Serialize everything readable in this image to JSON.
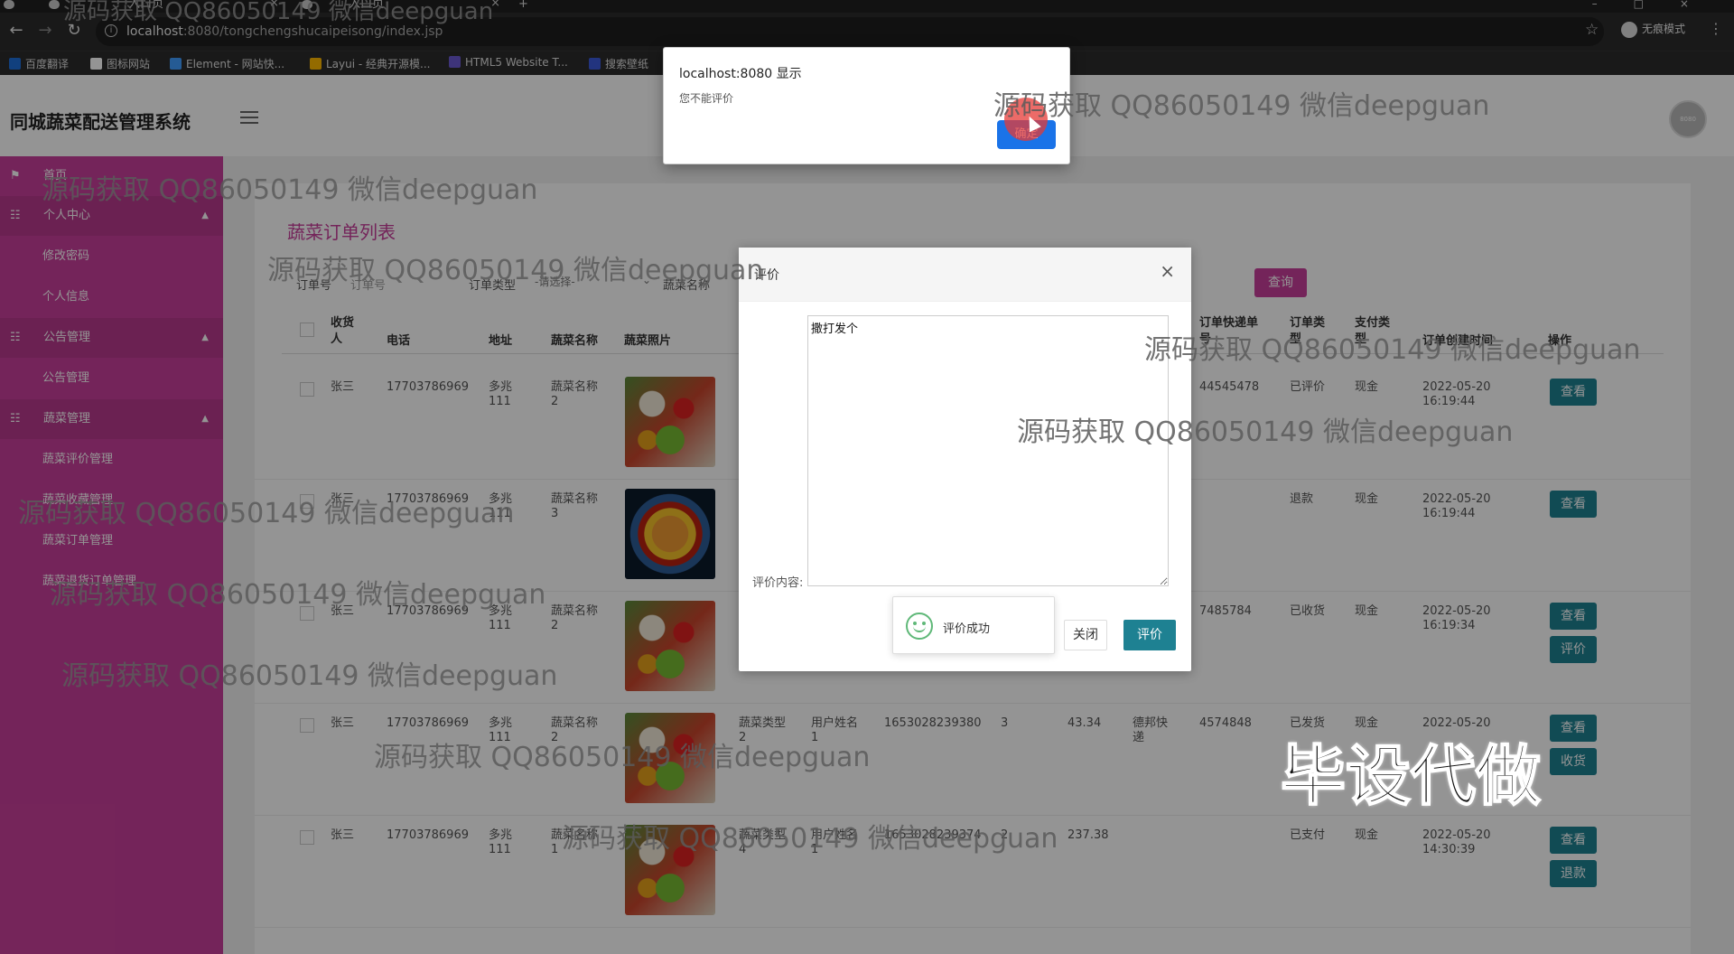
{
  "browser": {
    "tabs": [
      {
        "label": "入口页"
      },
      {
        "label": "入口页"
      }
    ],
    "new_tab": "+",
    "url_host": "localhost",
    "url_rest": ":8080/tongchengshucaipeisong/index.jsp",
    "incognito_label": "无痕模式",
    "bookmarks": [
      {
        "label": "百度翻译",
        "color": "#1e6fd9"
      },
      {
        "label": "图标网站",
        "color": "#ffffff"
      },
      {
        "label": "Element - 网站快...",
        "color": "#409eff"
      },
      {
        "label": "Layui - 经典开源模...",
        "color": "#ffb800"
      },
      {
        "label": "HTML5 Website T...",
        "color": "#6b5bd2"
      },
      {
        "label": "搜索壁纸",
        "color": "#3b5bdb"
      }
    ]
  },
  "app": {
    "title": "同城蔬菜配送管理系统",
    "avatar_text": "8080",
    "sidebar": {
      "home": "首页",
      "groups": [
        {
          "label": "个人中心",
          "items": [
            "修改密码",
            "个人信息"
          ]
        },
        {
          "label": "公告管理",
          "items": [
            "公告管理"
          ]
        },
        {
          "label": "蔬菜管理",
          "items": [
            "蔬菜评价管理",
            "蔬菜收藏管理",
            "蔬菜订单管理",
            "蔬菜退货订单管理"
          ]
        }
      ]
    },
    "content": {
      "title": "蔬菜订单列表",
      "filters": {
        "order_no_label": "订单号",
        "order_no_placeholder": "订单号",
        "type_label": "订单类型",
        "type_value": "-请选择-",
        "veg_name_label": "蔬菜名称",
        "query_button": "查询"
      },
      "columns": [
        "收货人",
        "电话",
        "地址",
        "蔬菜名称",
        "蔬菜照片",
        "订单快递单号",
        "订单类型",
        "支付类型",
        "订单创建时间",
        "操作"
      ],
      "rows": [
        {
          "receiver": "张三",
          "phone": "17703786969",
          "address": "多兆111",
          "veg": "蔬菜名称2",
          "photo": "veg1",
          "express": "44545478",
          "status": "已评价",
          "pay": "现金",
          "time": "2022-05-20 16:19:44",
          "buttons": [
            "查看"
          ]
        },
        {
          "receiver": "张三",
          "phone": "17703786969",
          "address": "多兆111",
          "veg": "蔬菜名称3",
          "photo": "veg2",
          "express": "",
          "status": "退款",
          "pay": "现金",
          "time": "2022-05-20 16:19:44",
          "buttons": [
            "查看"
          ]
        },
        {
          "receiver": "张三",
          "phone": "17703786969",
          "address": "多兆111",
          "veg": "蔬菜名称2",
          "photo": "veg1",
          "express": "7485784",
          "status": "已收货",
          "pay": "现金",
          "time": "2022-05-20 16:19:34",
          "buttons": [
            "查看",
            "评价"
          ]
        },
        {
          "receiver": "张三",
          "phone": "17703786969",
          "address": "多兆111",
          "veg": "蔬菜名称2",
          "photo": "veg1",
          "veg_type": "蔬菜类型2",
          "user": "用户姓名1",
          "order_no": "1653028239380",
          "qty": "3",
          "price": "43.34",
          "courier": "德邦快递",
          "express": "4574848",
          "status": "已发货",
          "pay": "现金",
          "time": "2022-05-20",
          "buttons": [
            "查看",
            "收货"
          ]
        },
        {
          "receiver": "张三",
          "phone": "17703786969",
          "address": "多兆111",
          "veg": "蔬菜名称1",
          "photo": "veg1",
          "veg_type": "蔬菜类型4",
          "user": "用户姓名1",
          "order_no": "1653028239374",
          "qty": "2",
          "price": "237.38",
          "express": "",
          "status": "已支付",
          "pay": "现金",
          "time": "2022-05-20 14:30:39",
          "buttons": [
            "查看",
            "退款"
          ]
        }
      ]
    }
  },
  "dialog": {
    "title": "评价",
    "close_icon": "×",
    "content_label": "评价内容:",
    "content_value": "撒打发个",
    "close_button": "关闭",
    "submit_button": "评价"
  },
  "toast": {
    "text": "评价成功"
  },
  "alert": {
    "title": "localhost:8080 显示",
    "message": "您不能评价",
    "ok_button": "确定"
  },
  "watermark": {
    "text": "源码获取 QQ86050149 微信deepguan",
    "big": "毕设代做"
  }
}
